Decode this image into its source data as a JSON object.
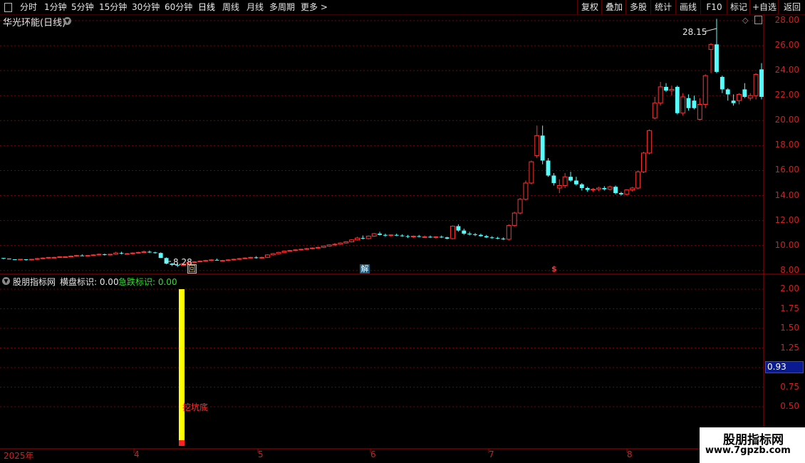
{
  "toolbar": {
    "periods": [
      "分时",
      "1分钟",
      "5分钟",
      "15分钟",
      "30分钟",
      "60分钟",
      "日线",
      "周线",
      "月线",
      "多周期",
      "更多 >"
    ],
    "active_period": "日线",
    "right_buttons": [
      "复权",
      "叠加",
      "多股",
      "统计",
      "画线",
      "F10",
      "标记",
      "+自选",
      "返回"
    ]
  },
  "stock": {
    "title": "华光环能(日线)"
  },
  "main_axis": {
    "labels": [
      "28.00",
      "26.00",
      "24.00",
      "22.00",
      "20.00",
      "18.00",
      "16.00",
      "14.00",
      "12.00",
      "10.00",
      "8.00"
    ]
  },
  "annotations": {
    "high": "28.15",
    "low": "8.28",
    "marker1": "回",
    "marker2": "解",
    "marker3": "$"
  },
  "indicator": {
    "name": "股朋指标网",
    "line_a": "横盘标识: 0.00",
    "line_b": "急跌标识: 0.00",
    "bar_label": "挖坑底",
    "axis_labels": [
      "2.00",
      "1.75",
      "1.50",
      "1.25",
      "0.75",
      "0.50"
    ],
    "current_value": "0.93"
  },
  "xaxis": {
    "labels": [
      "2025年",
      "4",
      "5",
      "6",
      "7",
      "8"
    ]
  },
  "watermark": {
    "name": "股朋指标网",
    "url": "www.7gpzb.com"
  },
  "colors": {
    "up": "#ff3333",
    "down": "#54fcfc",
    "grid": "#7a0000",
    "bar": "#ffff00"
  },
  "chart_data": {
    "type": "candlestick",
    "title": "华光环能(日线)",
    "ylim": [
      7.7,
      28.4
    ],
    "candles": [
      [
        9.0,
        9.0,
        8.9,
        8.95
      ],
      [
        8.95,
        8.95,
        8.9,
        8.9
      ],
      [
        8.9,
        8.9,
        8.85,
        8.85
      ],
      [
        8.85,
        8.9,
        8.8,
        8.9
      ],
      [
        8.9,
        8.9,
        8.8,
        8.85
      ],
      [
        8.85,
        8.9,
        8.8,
        8.9
      ],
      [
        8.9,
        9.0,
        8.85,
        8.95
      ],
      [
        8.95,
        9.05,
        8.9,
        9.0
      ],
      [
        9.0,
        9.05,
        8.95,
        9.05
      ],
      [
        9.05,
        9.1,
        9.0,
        9.05
      ],
      [
        9.05,
        9.15,
        9.0,
        9.1
      ],
      [
        9.1,
        9.15,
        9.05,
        9.1
      ],
      [
        9.1,
        9.2,
        9.05,
        9.15
      ],
      [
        9.15,
        9.25,
        9.1,
        9.2
      ],
      [
        9.2,
        9.3,
        9.15,
        9.15
      ],
      [
        9.15,
        9.25,
        9.1,
        9.2
      ],
      [
        9.2,
        9.3,
        9.15,
        9.25
      ],
      [
        9.25,
        9.35,
        9.2,
        9.3
      ],
      [
        9.3,
        9.35,
        9.2,
        9.25
      ],
      [
        9.25,
        9.3,
        9.2,
        9.3
      ],
      [
        9.3,
        9.5,
        9.25,
        9.4
      ],
      [
        9.4,
        9.5,
        9.3,
        9.35
      ],
      [
        9.35,
        9.4,
        9.3,
        9.35
      ],
      [
        9.35,
        9.45,
        9.3,
        9.4
      ],
      [
        9.4,
        9.5,
        9.35,
        9.45
      ],
      [
        9.45,
        9.6,
        9.4,
        9.5
      ],
      [
        9.5,
        9.6,
        9.4,
        9.45
      ],
      [
        9.45,
        9.5,
        9.35,
        9.4
      ],
      [
        9.4,
        9.45,
        9.0,
        9.0
      ],
      [
        9.0,
        9.05,
        8.5,
        8.55
      ],
      [
        8.55,
        8.6,
        8.35,
        8.45
      ],
      [
        8.45,
        8.55,
        8.28,
        8.4
      ],
      [
        8.4,
        8.6,
        8.35,
        8.55
      ],
      [
        8.55,
        8.7,
        8.5,
        8.65
      ],
      [
        8.65,
        8.75,
        8.6,
        8.7
      ],
      [
        8.7,
        8.8,
        8.65,
        8.75
      ],
      [
        8.75,
        8.85,
        8.7,
        8.8
      ],
      [
        8.8,
        8.9,
        8.75,
        8.85
      ],
      [
        8.85,
        8.95,
        8.8,
        8.8
      ],
      [
        8.8,
        8.85,
        8.7,
        8.8
      ],
      [
        8.8,
        8.9,
        8.75,
        8.85
      ],
      [
        8.85,
        8.95,
        8.8,
        8.9
      ],
      [
        8.9,
        9.0,
        8.85,
        8.95
      ],
      [
        8.95,
        9.05,
        8.9,
        9.0
      ],
      [
        9.0,
        9.1,
        8.95,
        9.05
      ],
      [
        9.05,
        9.15,
        8.95,
        9.0
      ],
      [
        9.0,
        9.1,
        8.95,
        9.05
      ],
      [
        9.05,
        9.3,
        9.0,
        9.25
      ],
      [
        9.25,
        9.4,
        9.2,
        9.35
      ],
      [
        9.35,
        9.5,
        9.3,
        9.45
      ],
      [
        9.45,
        9.6,
        9.4,
        9.55
      ],
      [
        9.55,
        9.65,
        9.5,
        9.6
      ],
      [
        9.6,
        9.7,
        9.55,
        9.65
      ],
      [
        9.65,
        9.75,
        9.6,
        9.7
      ],
      [
        9.7,
        9.8,
        9.65,
        9.75
      ],
      [
        9.75,
        9.85,
        9.7,
        9.8
      ],
      [
        9.8,
        9.9,
        9.75,
        9.85
      ],
      [
        9.85,
        10.0,
        9.8,
        9.95
      ],
      [
        9.95,
        10.1,
        9.9,
        10.05
      ],
      [
        10.05,
        10.2,
        10.0,
        10.1
      ],
      [
        10.1,
        10.25,
        10.05,
        10.2
      ],
      [
        10.2,
        10.35,
        10.15,
        10.3
      ],
      [
        10.3,
        10.5,
        10.25,
        10.45
      ],
      [
        10.45,
        10.7,
        10.4,
        10.6
      ],
      [
        10.6,
        10.8,
        10.5,
        10.55
      ],
      [
        10.55,
        10.8,
        10.5,
        10.75
      ],
      [
        10.75,
        11.0,
        10.7,
        10.95
      ],
      [
        10.95,
        11.1,
        10.8,
        10.85
      ],
      [
        10.85,
        10.95,
        10.7,
        10.8
      ],
      [
        10.8,
        10.9,
        10.7,
        10.85
      ],
      [
        10.85,
        10.95,
        10.75,
        10.8
      ],
      [
        10.8,
        10.9,
        10.7,
        10.75
      ],
      [
        10.75,
        10.85,
        10.6,
        10.7
      ],
      [
        10.7,
        10.8,
        10.6,
        10.75
      ],
      [
        10.75,
        10.85,
        10.65,
        10.7
      ],
      [
        10.7,
        10.8,
        10.6,
        10.7
      ],
      [
        10.7,
        10.8,
        10.6,
        10.65
      ],
      [
        10.65,
        10.75,
        10.55,
        10.7
      ],
      [
        10.7,
        10.8,
        10.6,
        10.65
      ],
      [
        10.65,
        10.7,
        10.5,
        10.55
      ],
      [
        10.55,
        11.6,
        10.5,
        11.55
      ],
      [
        11.55,
        11.7,
        11.1,
        11.2
      ],
      [
        11.2,
        11.35,
        10.85,
        10.95
      ],
      [
        10.95,
        11.1,
        10.8,
        10.9
      ],
      [
        10.9,
        11.0,
        10.75,
        10.85
      ],
      [
        10.85,
        10.95,
        10.7,
        10.75
      ],
      [
        10.75,
        10.85,
        10.6,
        10.65
      ],
      [
        10.65,
        10.75,
        10.55,
        10.6
      ],
      [
        10.6,
        10.7,
        10.5,
        10.55
      ],
      [
        10.55,
        10.65,
        10.45,
        10.5
      ],
      [
        10.5,
        11.7,
        10.4,
        11.6
      ],
      [
        11.6,
        12.7,
        11.5,
        12.6
      ],
      [
        12.6,
        13.8,
        12.5,
        13.7
      ],
      [
        13.7,
        15.2,
        13.6,
        15.0
      ],
      [
        15.0,
        16.8,
        14.9,
        16.7
      ],
      [
        17.2,
        19.6,
        17.0,
        18.8
      ],
      [
        18.8,
        19.6,
        16.5,
        16.8
      ],
      [
        16.8,
        17.0,
        15.5,
        15.6
      ],
      [
        15.6,
        15.8,
        14.8,
        15.0
      ],
      [
        14.6,
        15.3,
        14.2,
        14.8
      ],
      [
        14.8,
        15.8,
        14.6,
        15.5
      ],
      [
        15.5,
        15.9,
        15.1,
        15.2
      ],
      [
        15.2,
        15.5,
        14.8,
        14.9
      ],
      [
        14.9,
        15.0,
        14.4,
        14.6
      ],
      [
        14.6,
        14.7,
        14.3,
        14.45
      ],
      [
        14.45,
        14.6,
        14.3,
        14.5
      ],
      [
        14.5,
        14.7,
        14.35,
        14.6
      ],
      [
        14.6,
        14.75,
        14.4,
        14.5
      ],
      [
        14.5,
        14.8,
        14.4,
        14.7
      ],
      [
        14.7,
        14.8,
        14.1,
        14.2
      ],
      [
        14.2,
        14.3,
        14.0,
        14.1
      ],
      [
        14.1,
        14.5,
        14.0,
        14.45
      ],
      [
        14.45,
        14.7,
        14.3,
        14.6
      ],
      [
        14.6,
        16.0,
        14.5,
        15.9
      ],
      [
        15.9,
        17.5,
        15.8,
        17.4
      ],
      [
        17.4,
        19.3,
        17.3,
        19.2
      ],
      [
        20.2,
        21.9,
        20.1,
        21.4
      ],
      [
        21.4,
        23.1,
        21.2,
        22.7
      ],
      [
        22.7,
        23.0,
        22.3,
        22.4
      ],
      [
        22.4,
        22.8,
        22.0,
        22.5
      ],
      [
        22.7,
        22.8,
        20.5,
        20.6
      ],
      [
        20.6,
        22.2,
        20.4,
        21.9
      ],
      [
        21.8,
        22.1,
        20.8,
        21.0
      ],
      [
        21.6,
        22.0,
        20.9,
        21.0
      ],
      [
        20.1,
        21.8,
        20.0,
        21.3
      ],
      [
        21.3,
        23.7,
        21.0,
        23.6
      ],
      [
        25.7,
        26.2,
        23.8,
        26.1
      ],
      [
        26.1,
        28.15,
        23.8,
        23.9
      ],
      [
        23.5,
        23.6,
        22.2,
        22.5
      ],
      [
        22.5,
        22.6,
        21.6,
        22.1
      ],
      [
        21.6,
        22.1,
        21.2,
        21.4
      ],
      [
        21.6,
        22.2,
        21.3,
        22.1
      ],
      [
        22.5,
        23.0,
        21.8,
        21.9
      ],
      [
        21.8,
        22.2,
        21.6,
        22.0
      ],
      [
        22.0,
        23.8,
        21.7,
        23.7
      ],
      [
        24.1,
        24.6,
        21.7,
        21.9
      ]
    ]
  }
}
